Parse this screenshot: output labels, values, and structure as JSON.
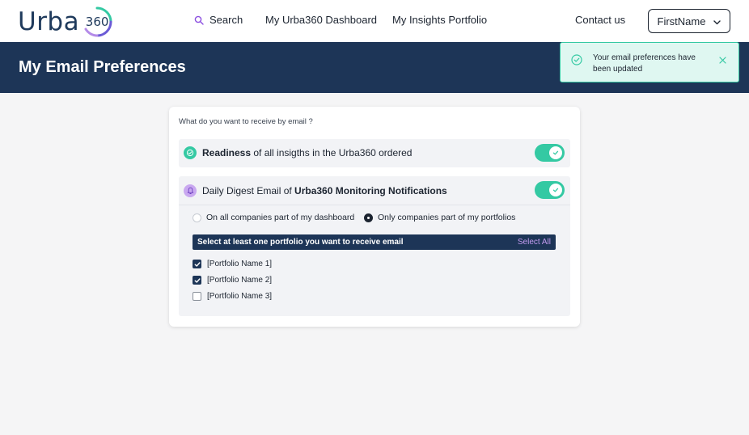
{
  "colors": {
    "navy": "#1d3557",
    "teal": "#34c9a3",
    "purple": "#c49cf0",
    "toast_bg": "#dff7f1"
  },
  "nav": {
    "logo_text": "Urba",
    "logo_number": "360",
    "search_label": "Search",
    "search_icon": "search-icon",
    "dashboard_label": "My Urba360 Dashboard",
    "insights_label": "My Insights Portfolio",
    "contact_label": "Contact us",
    "user_label": "FirstName",
    "user_icon": "chevron-down-icon"
  },
  "page": {
    "title": "My Email Preferences"
  },
  "toast": {
    "message": "Your email preferences have been updated",
    "icon": "check-circle-icon",
    "close_icon": "close-icon"
  },
  "prefs": {
    "question": "What do you want to receive by email ?",
    "readiness": {
      "bold": "Readiness",
      "rest": " of all insigths in the Urba360 ordered",
      "enabled": true,
      "icon": "check-circle-icon"
    },
    "digest": {
      "prefix": "Daily Digest Email of ",
      "bold": "Urba360 Monitoring Notifications",
      "enabled": true,
      "icon": "bell-icon",
      "scope_options": [
        {
          "label": "On all companies part of my dashboard",
          "selected": false
        },
        {
          "label": "Only companies part of my portfolios",
          "selected": true
        }
      ],
      "select_prompt": "Select at least one portfolio you want to receive email",
      "select_all_label": "Select All",
      "portfolios": [
        {
          "label": "[Portfolio Name 1]",
          "checked": true
        },
        {
          "label": "[Portfolio Name 2]",
          "checked": true
        },
        {
          "label": "[Portfolio Name 3]",
          "checked": false
        }
      ]
    }
  }
}
